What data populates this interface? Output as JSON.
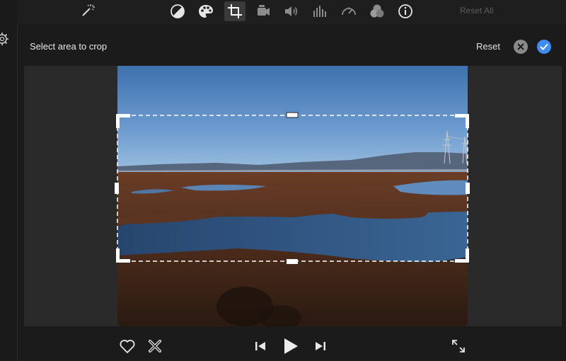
{
  "toolbar": {
    "tools": [
      {
        "name": "magic-wand"
      },
      {
        "name": "color-balance"
      },
      {
        "name": "color-correction"
      },
      {
        "name": "crop",
        "active": true
      },
      {
        "name": "stabilization"
      },
      {
        "name": "volume"
      },
      {
        "name": "noise-reduction-equalizer"
      },
      {
        "name": "speed"
      },
      {
        "name": "video-audio-effects"
      },
      {
        "name": "clip-info"
      }
    ],
    "reset_all_label": "Reset All"
  },
  "crop": {
    "instruction": "Select area to crop",
    "reset_label": "Reset",
    "cancel_icon": "close-icon",
    "apply_icon": "checkmark-icon"
  },
  "playback": {
    "buttons": [
      "favorite-heart-icon",
      "reject-x-icon",
      "skip-back-icon",
      "play-icon",
      "skip-forward-icon",
      "fullscreen-icon"
    ]
  },
  "colors": {
    "background": "#1b1b1b",
    "accent": "#3f8df3",
    "active_tool_bg": "#3a3a3a"
  }
}
